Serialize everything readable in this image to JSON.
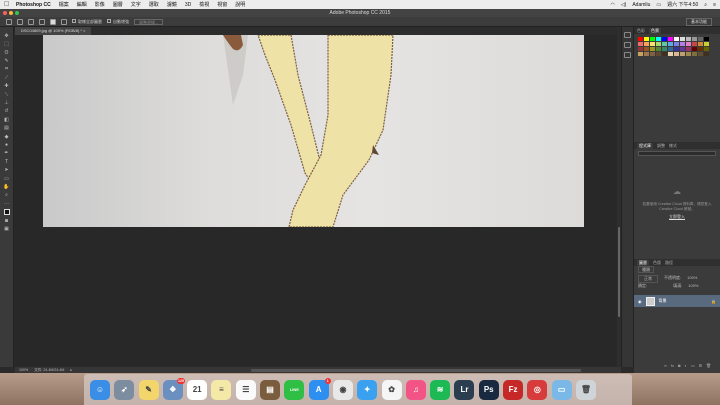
{
  "menubar": {
    "app_name": "Photoshop CC",
    "items": [
      "檔案",
      "編輯",
      "影像",
      "圖層",
      "文字",
      "選取",
      "濾鏡",
      "3D",
      "檢視",
      "視窗",
      "說明"
    ],
    "user": "Adamliu",
    "clock": "週六 下午4:50"
  },
  "window": {
    "title": "Adobe Photoshop CC 2015"
  },
  "options": {
    "sample_all_layers": "取樣全部圖層",
    "auto_enhance": "自動增強",
    "refine_edge": "調整邊緣...",
    "workspace": "基本功能"
  },
  "document": {
    "tab_label": "DSC04809.jpg @ 100% (RGB/8) *"
  },
  "status": {
    "zoom": "100%",
    "doc_size": "文件: 24.4M/24.4M"
  },
  "panels": {
    "color_tabs": [
      "色彩",
      "色票"
    ],
    "lib_tabs": [
      "程式庫",
      "調整",
      "樣式"
    ],
    "cc_message": "若要使用 Creative Cloud 資料庫，請您登入 Creative Cloud 帳號。",
    "cc_link": "立即登入",
    "layer_tabs": [
      "圖層",
      "色版",
      "路徑"
    ],
    "layer_kind": "種類",
    "blend_mode": "正常",
    "opacity_label": "不透明度:",
    "opacity_value": "100%",
    "lock_label": "鎖定:",
    "fill_label": "填滿:",
    "fill_value": "100%",
    "layer_name": "背景"
  },
  "swatch_colors": [
    "#ff0000",
    "#ffff00",
    "#00ff00",
    "#00ffff",
    "#0000ff",
    "#ff00ff",
    "#ffffff",
    "#dddddd",
    "#bbbbbb",
    "#999999",
    "#666666",
    "#000000",
    "#f26b6b",
    "#f7a35c",
    "#f9e46c",
    "#a7d96f",
    "#5cc9a7",
    "#5aa9e6",
    "#7b7fe6",
    "#b67fe6",
    "#e67fc5",
    "#cc4444",
    "#cc8833",
    "#cccc33",
    "#993333",
    "#995522",
    "#999922",
    "#558833",
    "#338866",
    "#336699",
    "#333399",
    "#663399",
    "#993366",
    "#660000",
    "#663300",
    "#666600",
    "#c8a060",
    "#a07850",
    "#806040",
    "#604830",
    "#403020",
    "#e8d0b0",
    "#d8b890",
    "#c0a070",
    "#a08850",
    "#807040",
    "#605030",
    "#403020"
  ],
  "dock": {
    "apps": [
      {
        "name": "Finder",
        "color": "#3a8ee6",
        "glyph": "☺"
      },
      {
        "name": "Launchpad",
        "color": "#7d8da0",
        "glyph": "➶"
      },
      {
        "name": "Stickies",
        "color": "#f2d56b",
        "glyph": "✎"
      },
      {
        "name": "Photos Preview",
        "color": "#6b8fbf",
        "glyph": "❖",
        "badge": "129"
      },
      {
        "name": "Calendar",
        "color": "#ffffff",
        "glyph": "21"
      },
      {
        "name": "Notes",
        "color": "#f5e9a8",
        "glyph": "≡"
      },
      {
        "name": "Reminders",
        "color": "#fafafa",
        "glyph": "☰"
      },
      {
        "name": "Notebook",
        "color": "#7a5c3e",
        "glyph": "▤"
      },
      {
        "name": "LINE",
        "color": "#2fbf45",
        "glyph": "LINE"
      },
      {
        "name": "App Store",
        "color": "#2d8ff0",
        "glyph": "A",
        "badge": "1"
      },
      {
        "name": "Chrome",
        "color": "#e8e8e8",
        "glyph": "◉"
      },
      {
        "name": "Safari",
        "color": "#3aa0f0",
        "glyph": "✦"
      },
      {
        "name": "Photos",
        "color": "#f5f5f5",
        "glyph": "✿"
      },
      {
        "name": "iTunes",
        "color": "#f25585",
        "glyph": "♫"
      },
      {
        "name": "Spotify",
        "color": "#1db954",
        "glyph": "≋"
      },
      {
        "name": "Lightroom",
        "color": "#2a3e4f",
        "glyph": "Lr"
      },
      {
        "name": "Photoshop",
        "color": "#19293f",
        "glyph": "Ps"
      },
      {
        "name": "FileZilla",
        "color": "#c62828",
        "glyph": "Fz"
      },
      {
        "name": "Ribbon app",
        "color": "#d83b3b",
        "glyph": "◎"
      },
      {
        "name": "Downloads folder",
        "color": "#7ab8e8",
        "glyph": "▭"
      },
      {
        "name": "Trash",
        "color": "#cfd4d8",
        "glyph": "🗑"
      }
    ]
  }
}
